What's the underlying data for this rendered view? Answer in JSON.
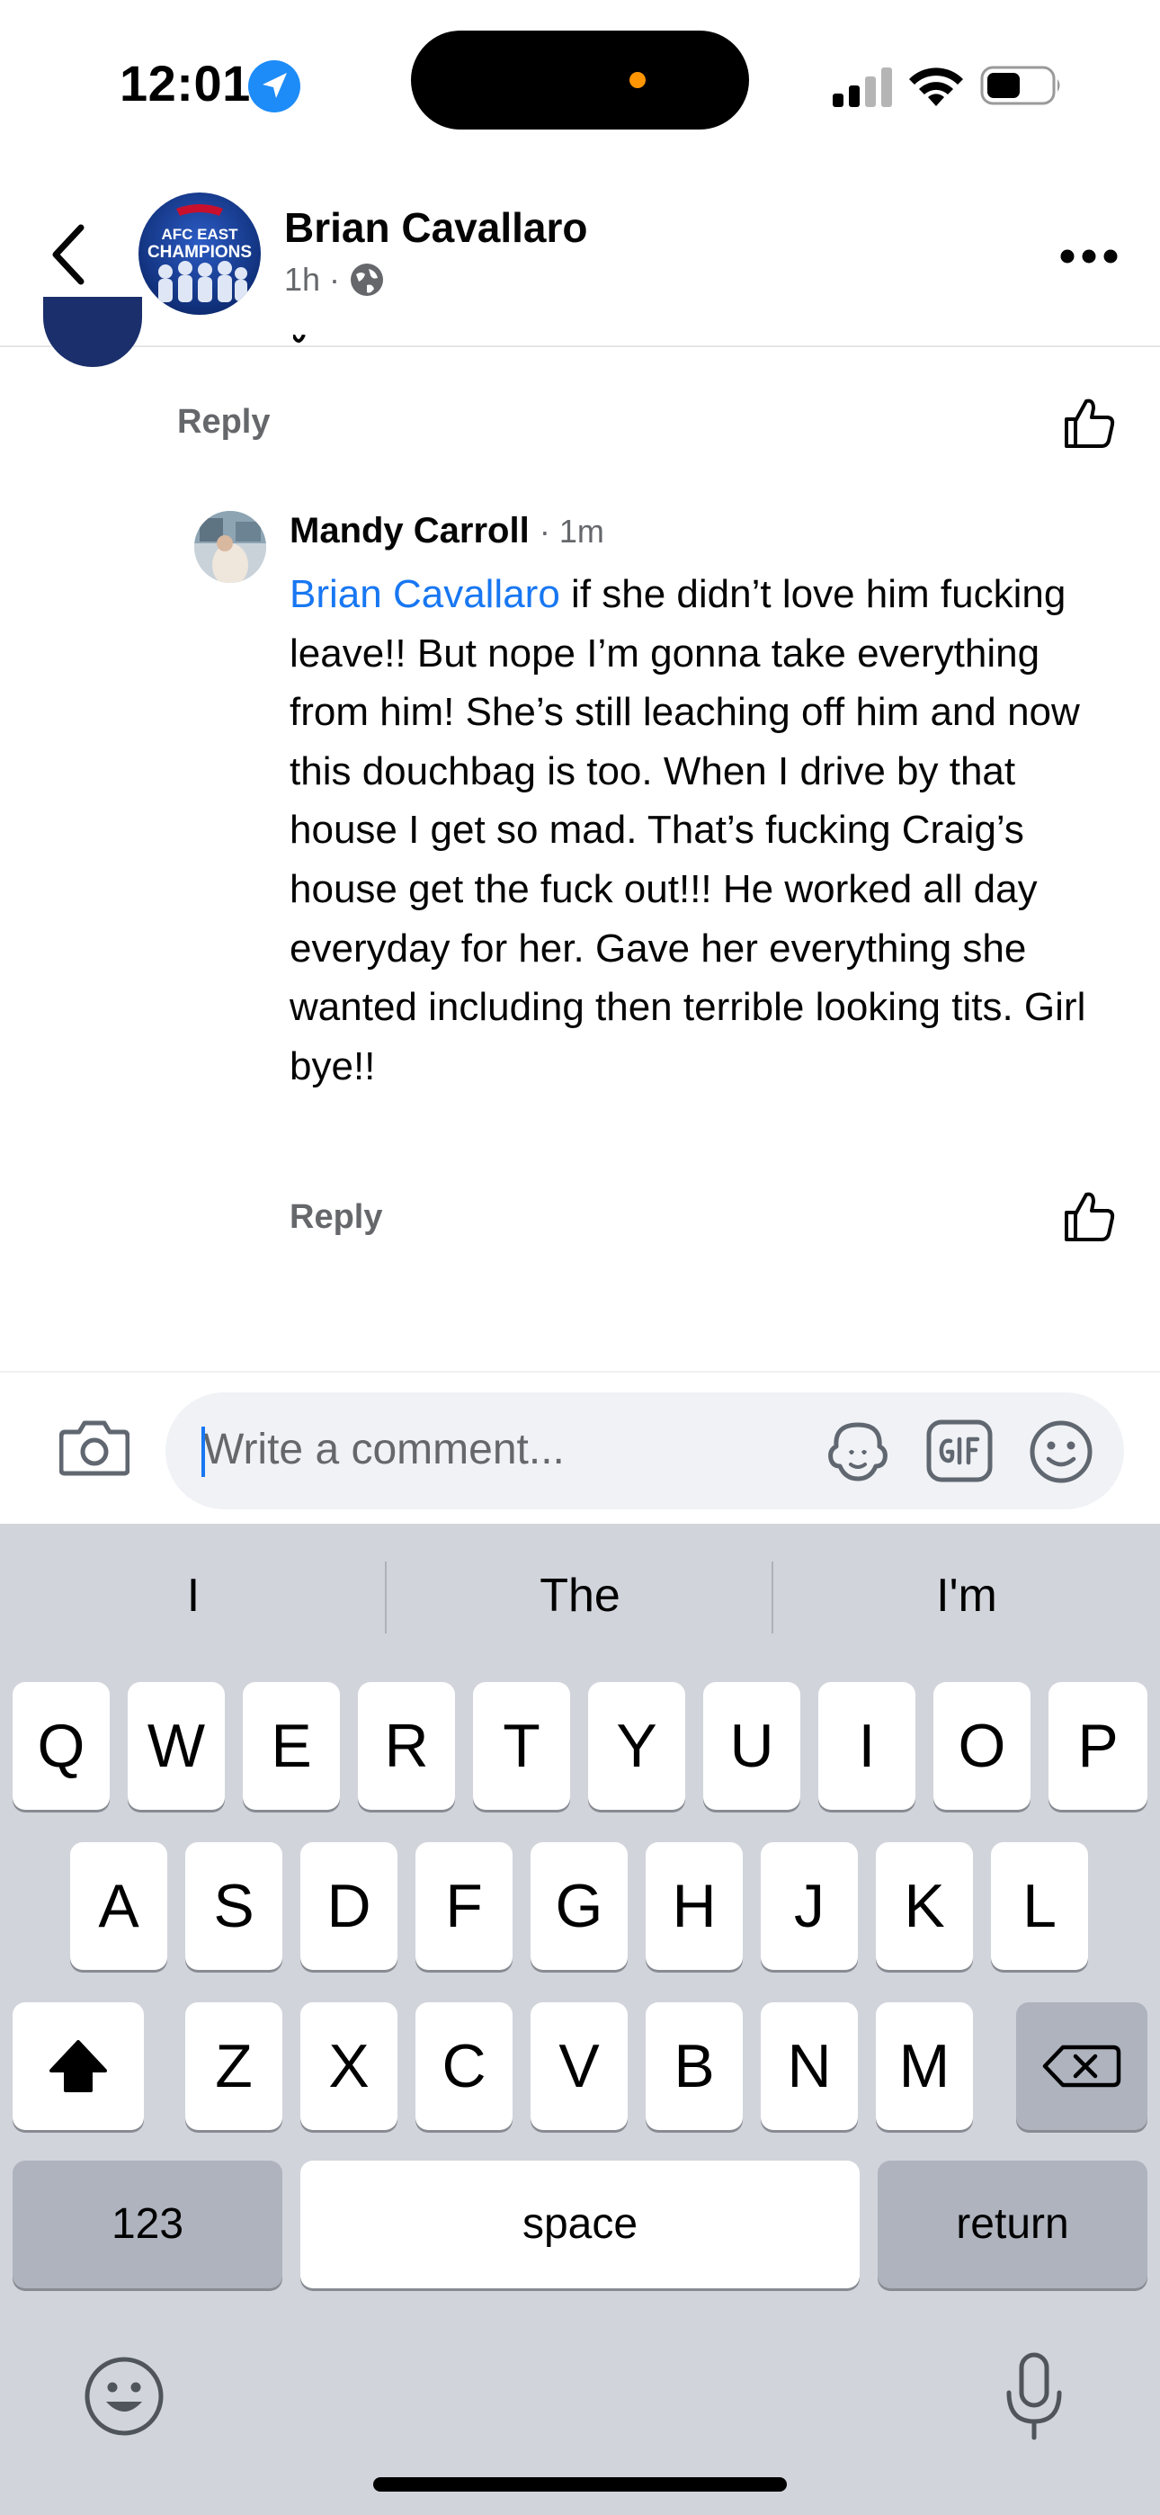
{
  "status_bar": {
    "time": "12:01",
    "icons": [
      "location-arrow-icon",
      "cellular-signal-icon",
      "wifi-icon",
      "battery-icon"
    ]
  },
  "header": {
    "name": "Brian Cavallaro",
    "time_ago": "1h",
    "separator": "·",
    "privacy_icon": "globe-icon",
    "avatar_text_line1": "AFC EAST",
    "avatar_text_line2": "CHAMPIONS"
  },
  "comments": [
    {
      "reply_label": "Reply"
    },
    {
      "author": "Mandy Carroll",
      "time_ago": "· 1m",
      "mention": "Brian Cavallaro",
      "body": " if she didn’t love him fucking leave!! But nope I’m gonna take everything from him! She’s still leaching off him and now this douchbag is too. When I drive by that house I get so mad. That’s fucking Craig’s house get the fuck out!!! He worked all day everyday for her. Gave her everything she wanted including then terrible looking tits. Girl bye!!",
      "reply_label": "Reply"
    }
  ],
  "composer": {
    "placeholder": "Write a comment...",
    "icons": [
      "camera-icon",
      "avatar-sticker-icon",
      "gif-icon",
      "emoji-icon"
    ]
  },
  "keyboard": {
    "suggestions": [
      "I",
      "The",
      "I'm"
    ],
    "row1": [
      "Q",
      "W",
      "E",
      "R",
      "T",
      "Y",
      "U",
      "I",
      "O",
      "P"
    ],
    "row2": [
      "A",
      "S",
      "D",
      "F",
      "G",
      "H",
      "J",
      "K",
      "L"
    ],
    "row3": [
      "Z",
      "X",
      "C",
      "V",
      "B",
      "N",
      "M"
    ],
    "numbers_label": "123",
    "space_label": "space",
    "return_label": "return"
  },
  "colors": {
    "link_blue": "#1877f2",
    "secondary_text": "#65676b",
    "keyboard_bg": "#d1d4db"
  }
}
